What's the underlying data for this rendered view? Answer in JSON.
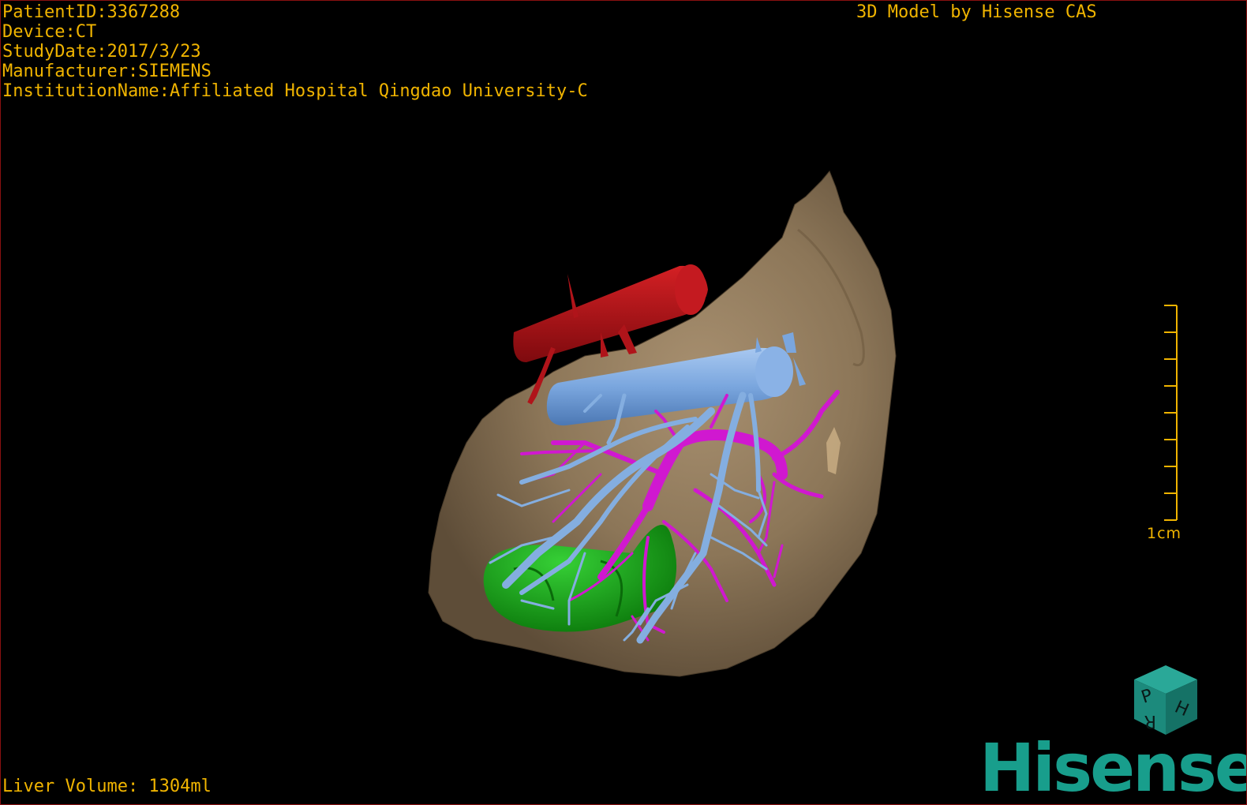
{
  "patient_info": {
    "patient_id": "PatientID:3367288",
    "device": "Device:CT",
    "study_date": "StudyDate:2017/3/23",
    "manufacturer": "Manufacturer:SIEMENS",
    "institution": "InstitutionName:Affiliated Hospital Qingdao University-C"
  },
  "model_credit": "3D Model by Hisense CAS",
  "liver_volume": "Liver Volume: 1304ml",
  "scale": {
    "label": "1cm"
  },
  "orientation_cube": {
    "labels": [
      "P",
      "H",
      "R"
    ]
  },
  "brand": {
    "name": "Hisense"
  },
  "colors": {
    "overlay_text": "#f0b400",
    "liver": "#8a7356",
    "artery": "#b0141a",
    "vena_cava": "#7aa6de",
    "portal_vein": "#d018d0",
    "hepatic_vein": "#84aee0",
    "gallbladder": "#18a818",
    "brand": "#189e8c"
  }
}
